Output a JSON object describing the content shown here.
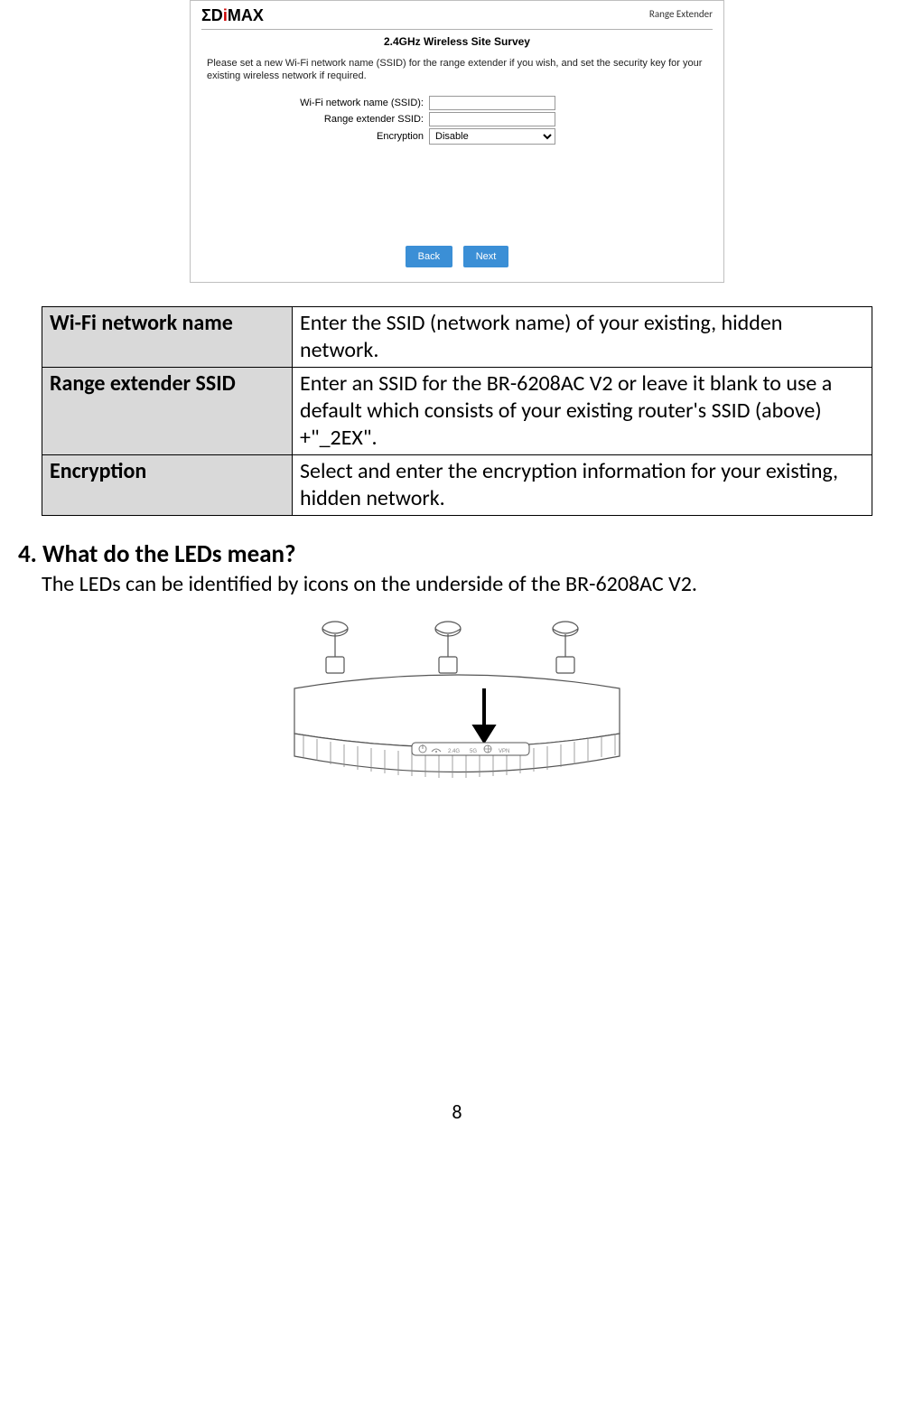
{
  "screenshot": {
    "logo_text_prefix": "ΣD",
    "logo_text_mid": "i",
    "logo_text_suffix": "MAX",
    "mode_label": "Range Extender",
    "title": "2.4GHz  Wireless Site Survey",
    "instruction": "Please set a new Wi-Fi network name (SSID) for the range extender if you wish, and set the security key for your existing wireless network if required.",
    "labels": {
      "ssid": "Wi-Fi network name (SSID):",
      "ext_ssid": "Range extender SSID:",
      "encryption": "Encryption"
    },
    "encryption_value": "Disable",
    "btn_back": "Back",
    "btn_next": "Next"
  },
  "table": {
    "rows": [
      {
        "head": "Wi-Fi network name",
        "body": "Enter the SSID (network name) of your existing, hidden network."
      },
      {
        "head": "Range extender SSID",
        "body": "Enter an SSID for the BR-6208AC V2 or leave it blank to use a default which consists of your existing router's SSID (above) +\"_2EX\"."
      },
      {
        "head": "Encryption",
        "body": "Select and enter the encryption information for your existing, hidden network."
      }
    ]
  },
  "section": {
    "heading": "4. What do the LEDs mean?",
    "text": "The LEDs can be identified by icons on the underside of the BR-6208AC V2."
  },
  "device_labels": {
    "led1": "2.4G",
    "led2": "5G",
    "led3": "VPN"
  },
  "page_number": "8"
}
